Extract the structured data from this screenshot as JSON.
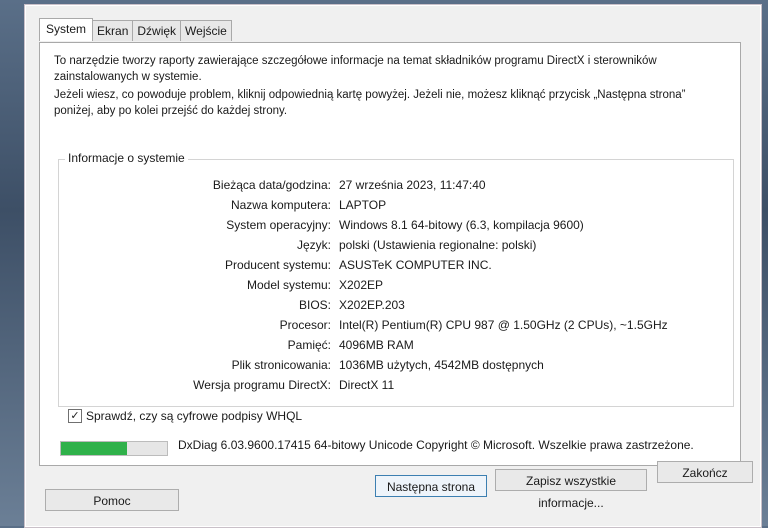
{
  "tabs": [
    {
      "label": "System",
      "active": true
    },
    {
      "label": "Ekran",
      "active": false
    },
    {
      "label": "Dźwięk",
      "active": false
    },
    {
      "label": "Wejście",
      "active": false
    }
  ],
  "intro": {
    "paragraph1": "To narzędzie tworzy raporty zawierające szczegółowe informacje na temat składników programu DirectX i sterowników zainstalowanych w systemie.",
    "paragraph2": "Jeżeli wiesz, co powoduje problem, kliknij odpowiednią kartę powyżej. Jeżeli nie, możesz kliknąć przycisk „Następna strona” poniżej, aby po kolei przejść do każdej strony."
  },
  "system_info": {
    "title": "Informacje o systemie",
    "rows": [
      {
        "label": "Bieżąca data/godzina:",
        "value": "27 września 2023, 11:47:40"
      },
      {
        "label": "Nazwa komputera:",
        "value": "LAPTOP"
      },
      {
        "label": "System operacyjny:",
        "value": "Windows 8.1 64-bitowy (6.3, kompilacja 9600)"
      },
      {
        "label": "Język:",
        "value": "polski (Ustawienia regionalne: polski)"
      },
      {
        "label": "Producent systemu:",
        "value": "ASUSTeK COMPUTER INC."
      },
      {
        "label": "Model systemu:",
        "value": "X202EP"
      },
      {
        "label": "BIOS:",
        "value": "X202EP.203"
      },
      {
        "label": "Procesor:",
        "value": "Intel(R) Pentium(R) CPU 987 @ 1.50GHz (2 CPUs), ~1.5GHz"
      },
      {
        "label": "Pamięć:",
        "value": "4096MB RAM"
      },
      {
        "label": "Plik stronicowania:",
        "value": "1036MB użytych, 4542MB dostępnych"
      },
      {
        "label": "Wersja programu DirectX:",
        "value": "DirectX 11"
      }
    ]
  },
  "whql": {
    "label": "Sprawdź, czy są cyfrowe podpisy WHQL",
    "checked": true,
    "check_glyph": "✓"
  },
  "progress": {
    "fraction": 0.62,
    "color": "#2fb14a"
  },
  "footer_info": "DxDiag 6.03.9600.17415 64-bitowy Unicode  Copyright © Microsoft. Wszelkie prawa zastrzeżone.",
  "buttons": {
    "help": "Pomoc",
    "next": "Następna strona",
    "save": "Zapisz wszystkie informacje...",
    "exit": "Zakończ"
  }
}
